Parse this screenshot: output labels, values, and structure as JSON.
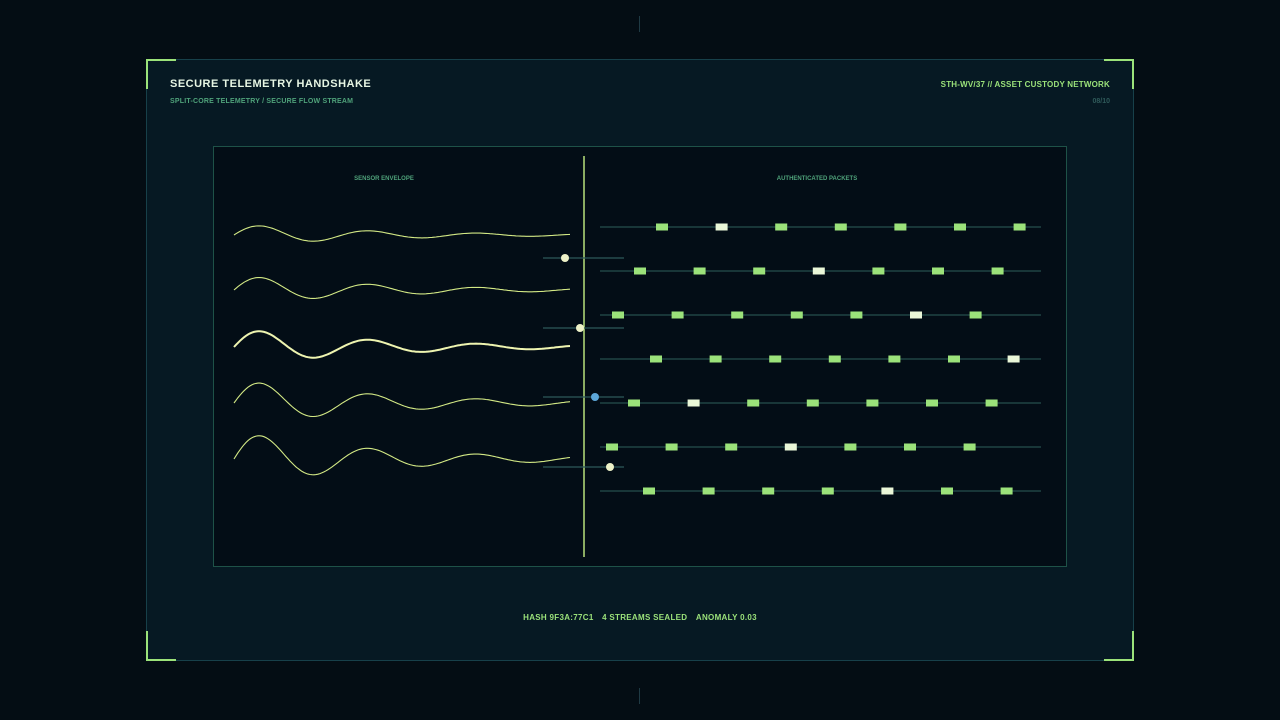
{
  "header": {
    "title": "SECURE TELEMETRY HANDSHAKE",
    "subtitle": "SPLIT-CORE TELEMETRY / SECURE FLOW STREAM",
    "tag": "STH-WV/37  //  ASSET CUSTODY NETWORK",
    "page": "08/10"
  },
  "panels": {
    "left_label": "SENSOR ENVELOPE",
    "right_label": "AUTHENTICATED PACKETS"
  },
  "status": {
    "hash": "HASH 9F3A:77C1",
    "streams": "4 STREAMS SEALED",
    "anomaly": "ANOMALY 0.03"
  },
  "colors": {
    "accent": "#9be27a",
    "wave": "#d3e985",
    "highlight_packet": "#eaf7d8",
    "node_blue": "#5da7d9",
    "node_cream": "#eef2c8"
  },
  "waves": [
    {
      "amp": 11,
      "highlight": false
    },
    {
      "amp": 15,
      "highlight": false
    },
    {
      "amp": 19,
      "highlight": true
    },
    {
      "amp": 24,
      "highlight": false
    },
    {
      "amp": 28,
      "highlight": false
    }
  ],
  "handshake_nodes": [
    {
      "color": "cream"
    },
    {
      "color": "cream"
    },
    {
      "color": "blue"
    },
    {
      "color": "cream"
    }
  ],
  "packet_rows": [
    {
      "highlight_index": 1
    },
    {
      "highlight_index": 3
    },
    {
      "highlight_index": 5
    },
    {
      "highlight_index": 6
    },
    {
      "highlight_index": 1
    },
    {
      "highlight_index": 3
    },
    {
      "highlight_index": 4
    }
  ]
}
